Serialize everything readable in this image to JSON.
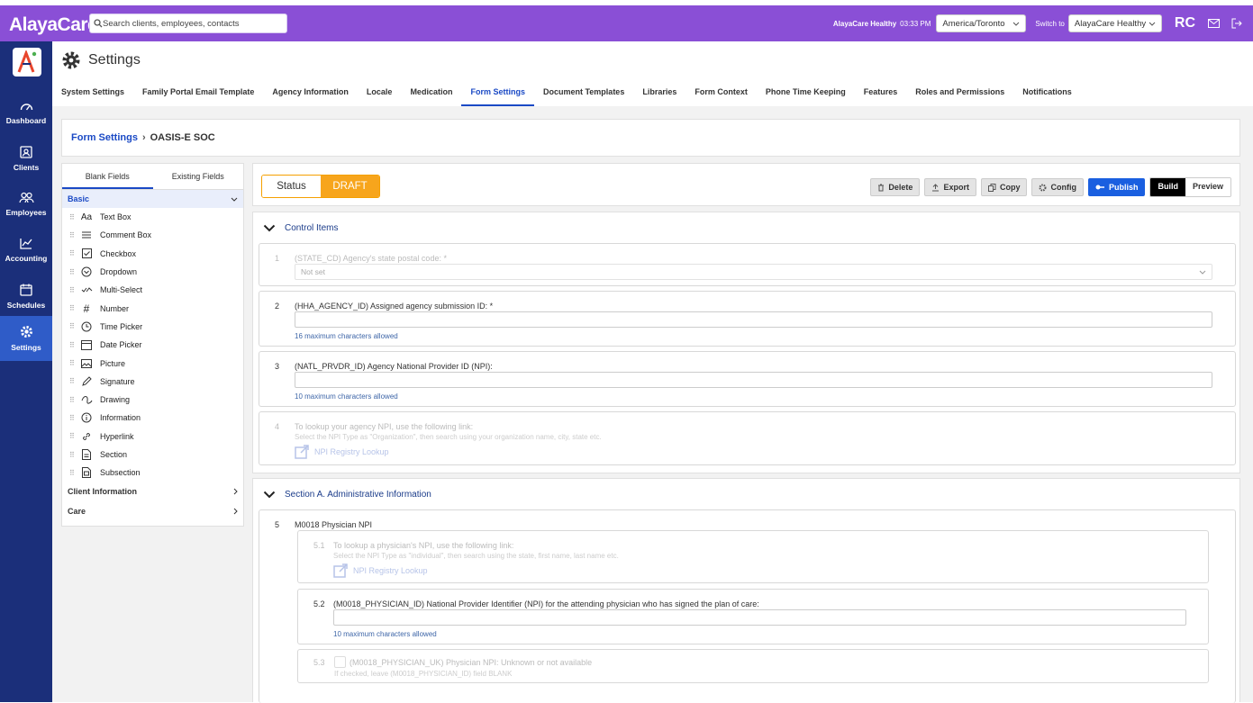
{
  "app": {
    "logo": "AlayaCare",
    "search_placeholder": "Search clients, employees, contacts",
    "org_name": "AlayaCare Healthy",
    "time": "03:33 PM",
    "timezone": "America/Toronto",
    "switch_label": "Switch to",
    "switch_value": "AlayaCare Healthy",
    "user_initials": "RC"
  },
  "nav": [
    {
      "label": "Dashboard",
      "icon": "dashboard-icon"
    },
    {
      "label": "Clients",
      "icon": "clients-icon"
    },
    {
      "label": "Employees",
      "icon": "employees-icon"
    },
    {
      "label": "Accounting",
      "icon": "accounting-icon"
    },
    {
      "label": "Schedules",
      "icon": "schedules-icon"
    },
    {
      "label": "Settings",
      "icon": "settings-icon",
      "active": true
    }
  ],
  "page": {
    "title": "Settings",
    "tabs": [
      "System Settings",
      "Family Portal Email Template",
      "Agency Information",
      "Locale",
      "Medication",
      "Form Settings",
      "Document Templates",
      "Libraries",
      "Form Context",
      "Phone Time Keeping",
      "Features",
      "Roles and Permissions",
      "Notifications"
    ],
    "active_tab": "Form Settings"
  },
  "breadcrumb": {
    "parent": "Form Settings",
    "current": "OASIS-E SOC"
  },
  "palette": {
    "tabs": [
      "Blank Fields",
      "Existing Fields"
    ],
    "sections": [
      "Basic",
      "Client Information",
      "Care"
    ],
    "fields": [
      "Text Box",
      "Comment Box",
      "Checkbox",
      "Dropdown",
      "Multi-Select",
      "Number",
      "Time Picker",
      "Date Picker",
      "Picture",
      "Signature",
      "Drawing",
      "Information",
      "Hyperlink",
      "Section",
      "Subsection"
    ]
  },
  "form": {
    "status_label": "Status",
    "status_value": "DRAFT",
    "actions": [
      "Delete",
      "Export",
      "Copy",
      "Config",
      "Publish"
    ],
    "modes": [
      "Build",
      "Preview"
    ],
    "sections": [
      {
        "title": "Control Items"
      },
      {
        "title": "Section A. Administrative Information"
      }
    ],
    "questions": {
      "q1": {
        "num": "1",
        "label": "(STATE_CD) Agency's state postal code: *",
        "value": "Not set"
      },
      "q2": {
        "num": "2",
        "label": "(HHA_AGENCY_ID) Assigned agency submission ID: *",
        "hint": "16 maximum characters allowed"
      },
      "q3": {
        "num": "3",
        "label": "(NATL_PRVDR_ID) Agency National Provider ID (NPI):",
        "hint": "10 maximum characters allowed"
      },
      "q4": {
        "num": "4",
        "label": "To lookup your agency NPI, use the following link:",
        "sub": "Select the NPI Type as \"Organization\", then search using your organization name, city, state etc.",
        "link": "NPI Registry Lookup"
      },
      "q5": {
        "num": "5",
        "label": "M0018 Physician NPI"
      },
      "q51": {
        "num": "5.1",
        "label": "To lookup a physician's NPI, use the following link:",
        "sub": "Select the NPI Type as \"individual\", then search using the state, first name, last name etc.",
        "link": "NPI Registry Lookup"
      },
      "q52": {
        "num": "5.2",
        "label": "(M0018_PHYSICIAN_ID) National Provider Identifier (NPI) for the attending physician who has signed the plan of care:",
        "hint": "10 maximum characters allowed"
      },
      "q53": {
        "num": "5.3",
        "label": "(M0018_PHYSICIAN_UK) Physician NPI: Unknown or not available",
        "sub": "If checked, leave (M0018_PHYSICIAN_ID) field BLANK"
      }
    }
  }
}
